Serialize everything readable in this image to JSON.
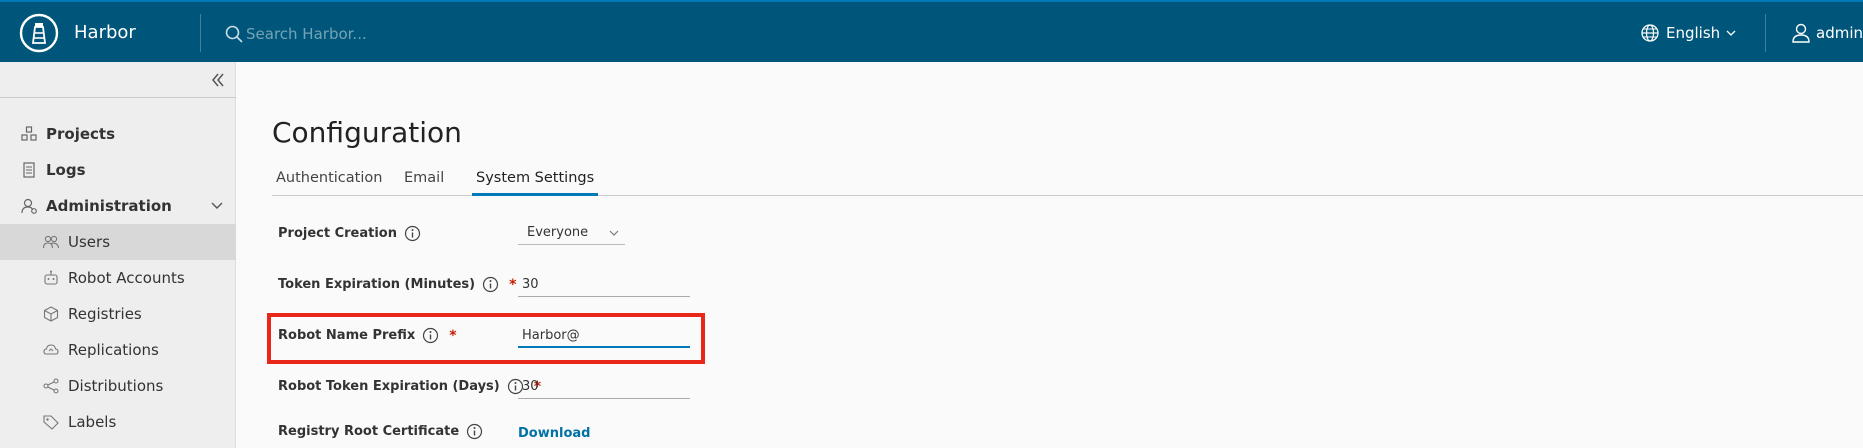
{
  "header": {
    "brand": "Harbor",
    "search_placeholder": "Search Harbor...",
    "language": "English",
    "user": "admin"
  },
  "sidebar": {
    "items": [
      {
        "label": "Projects",
        "icon": "projects-icon"
      },
      {
        "label": "Logs",
        "icon": "logs-icon"
      },
      {
        "label": "Administration",
        "icon": "administration-icon",
        "expanded": true
      },
      {
        "label": "Users",
        "icon": "users-icon",
        "active": true
      },
      {
        "label": "Robot Accounts",
        "icon": "robot-icon"
      },
      {
        "label": "Registries",
        "icon": "registries-icon"
      },
      {
        "label": "Replications",
        "icon": "replications-icon"
      },
      {
        "label": "Distributions",
        "icon": "distributions-icon"
      },
      {
        "label": "Labels",
        "icon": "labels-icon"
      }
    ]
  },
  "main": {
    "title": "Configuration",
    "tabs": [
      {
        "label": "Authentication"
      },
      {
        "label": "Email"
      },
      {
        "label": "System Settings",
        "active": true
      }
    ],
    "form": {
      "project_creation_label": "Project Creation",
      "project_creation_value": "Everyone",
      "token_expiration_label": "Token Expiration (Minutes)",
      "token_expiration_value": "30",
      "robot_prefix_label": "Robot Name Prefix",
      "robot_prefix_value": "Harbor@",
      "robot_token_label": "Robot Token Expiration (Days)",
      "robot_token_value": "30",
      "root_cert_label": "Registry Root Certificate",
      "download_label": "Download",
      "required_mark": "*"
    }
  },
  "colors": {
    "header_bg": "#00567a",
    "accent": "#0079b8",
    "highlight": "#e8261a",
    "required": "#c21d00"
  }
}
